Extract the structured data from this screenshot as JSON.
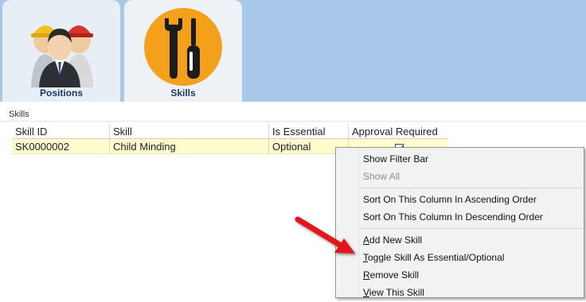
{
  "tabs": [
    {
      "label": "Positions",
      "icon": "workers-icon"
    },
    {
      "label": "Skills",
      "icon": "tools-icon"
    }
  ],
  "pane": {
    "title": "Skills"
  },
  "grid": {
    "columns": [
      "Skill ID",
      "Skill",
      "Is Essential",
      "Approval Required"
    ],
    "rows": [
      {
        "skill_id": "SK0000002",
        "skill": "Child Minding",
        "is_essential": "Optional",
        "approval_required": true
      }
    ]
  },
  "context_menu": {
    "items": [
      {
        "label": "Show Filter Bar",
        "enabled": true
      },
      {
        "label": "Show All",
        "enabled": false
      },
      {
        "label": "Sort On This Column In Ascending Order",
        "enabled": true
      },
      {
        "label": "Sort On This Column In Descending Order",
        "enabled": true
      },
      {
        "label_rest": "dd New Skill",
        "mnemonic": "A",
        "enabled": true
      },
      {
        "label_rest": "oggle Skill As Essential/Optional",
        "mnemonic": "T",
        "enabled": true
      },
      {
        "label_rest": "emove Skill",
        "mnemonic": "R",
        "enabled": true
      },
      {
        "label_rest": "iew This Skill",
        "mnemonic": "V",
        "enabled": true
      }
    ]
  },
  "colors": {
    "tabstrip": "#a8c8ea",
    "row_highlight": "#fffccd",
    "skills_icon_bg": "#f5a01a",
    "arrow": "#e3161c"
  }
}
